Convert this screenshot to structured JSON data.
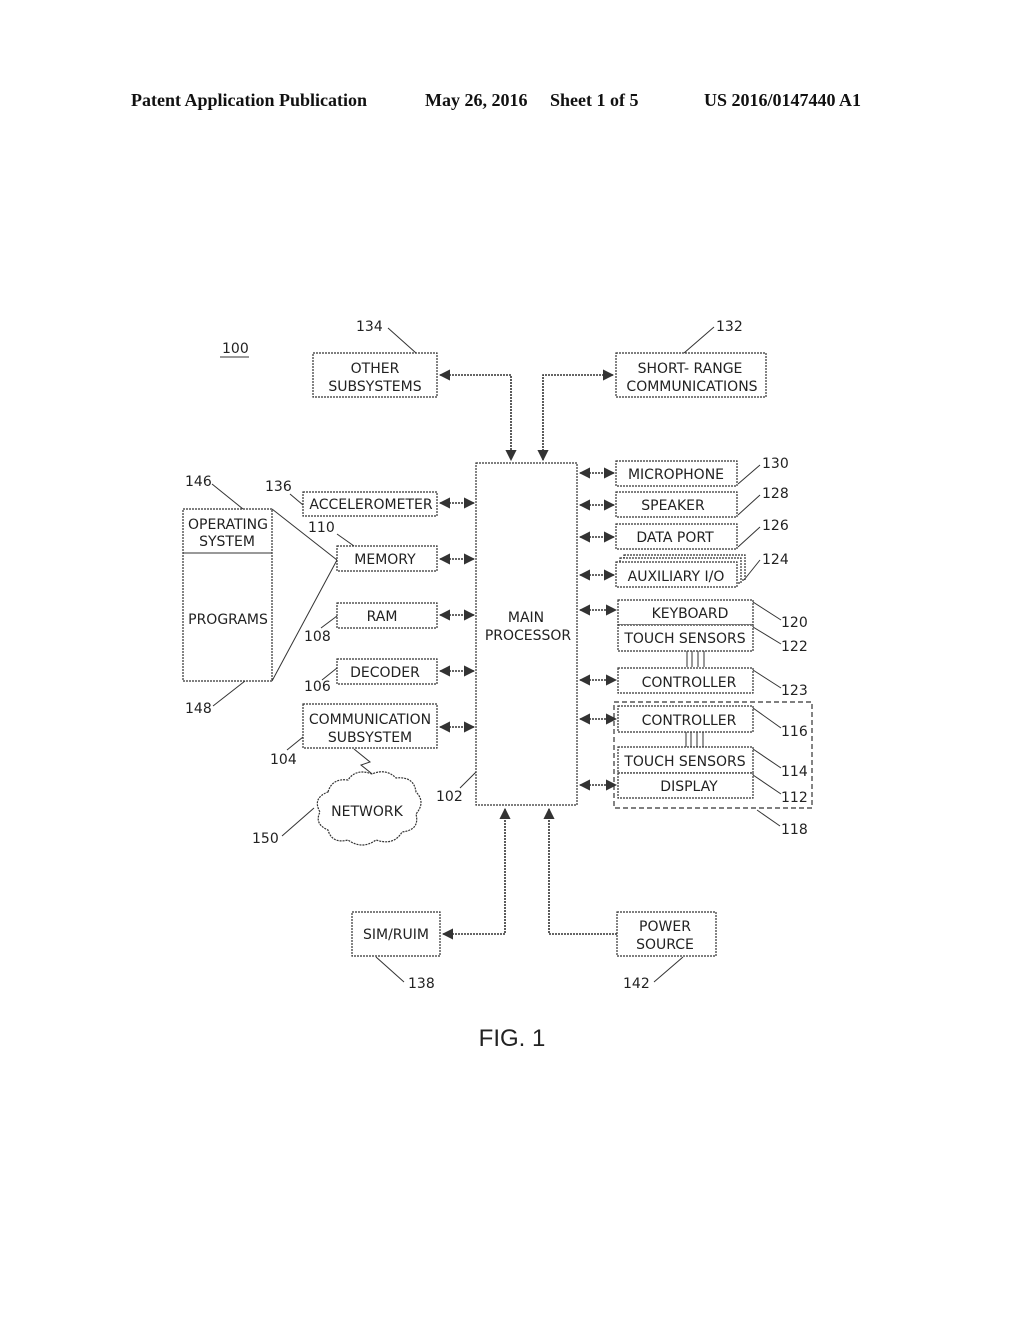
{
  "header": {
    "publication": "Patent Application Publication",
    "date": "May 26, 2016",
    "sheet": "Sheet 1 of 5",
    "number": "US 2016/0147440 A1"
  },
  "figure": {
    "caption": "FIG. 1",
    "device_ref": "100",
    "blocks": {
      "main_processor": {
        "line1": "MAIN",
        "line2": "PROCESSOR",
        "ref": "102"
      },
      "other_subsystems": {
        "line1": "OTHER",
        "line2": "SUBSYSTEMS",
        "ref": "134"
      },
      "short_range": {
        "line1": "SHORT- RANGE",
        "line2": "COMMUNICATIONS",
        "ref": "132"
      },
      "accelerometer": {
        "label": "ACCELEROMETER",
        "ref": "136"
      },
      "memory": {
        "label": "MEMORY",
        "ref": "110"
      },
      "ram": {
        "label": "RAM",
        "ref": "108"
      },
      "decoder": {
        "label": "DECODER",
        "ref": "106"
      },
      "communication": {
        "line1": "COMMUNICATION",
        "line2": "SUBSYSTEM",
        "ref": "104"
      },
      "network": {
        "label": "NETWORK",
        "ref": "150"
      },
      "operating_system": {
        "line1": "OPERATING",
        "line2": "SYSTEM",
        "ref": "146"
      },
      "programs": {
        "label": "PROGRAMS",
        "ref": "148"
      },
      "microphone": {
        "label": "MICROPHONE",
        "ref": "130"
      },
      "speaker": {
        "label": "SPEAKER",
        "ref": "128"
      },
      "data_port": {
        "label": "DATA PORT",
        "ref": "126"
      },
      "auxiliary_io": {
        "label": "AUXILIARY I/O",
        "ref": "124"
      },
      "keyboard": {
        "label": "KEYBOARD",
        "ref": "120"
      },
      "touch_sensors_kb": {
        "label": "TOUCH SENSORS",
        "ref": "122"
      },
      "controller_kb": {
        "label": "CONTROLLER",
        "ref": "123"
      },
      "controller_display": {
        "label": "CONTROLLER",
        "ref": "116"
      },
      "touch_sensors_display": {
        "label": "TOUCH SENSORS",
        "ref": "114"
      },
      "display": {
        "label": "DISPLAY",
        "ref": "112"
      },
      "touchscreen_group": {
        "ref": "118"
      },
      "sim_ruim": {
        "label": "SIM/RUIM",
        "ref": "138"
      },
      "power_source": {
        "line1": "POWER",
        "line2": "SOURCE",
        "ref": "142"
      }
    }
  }
}
